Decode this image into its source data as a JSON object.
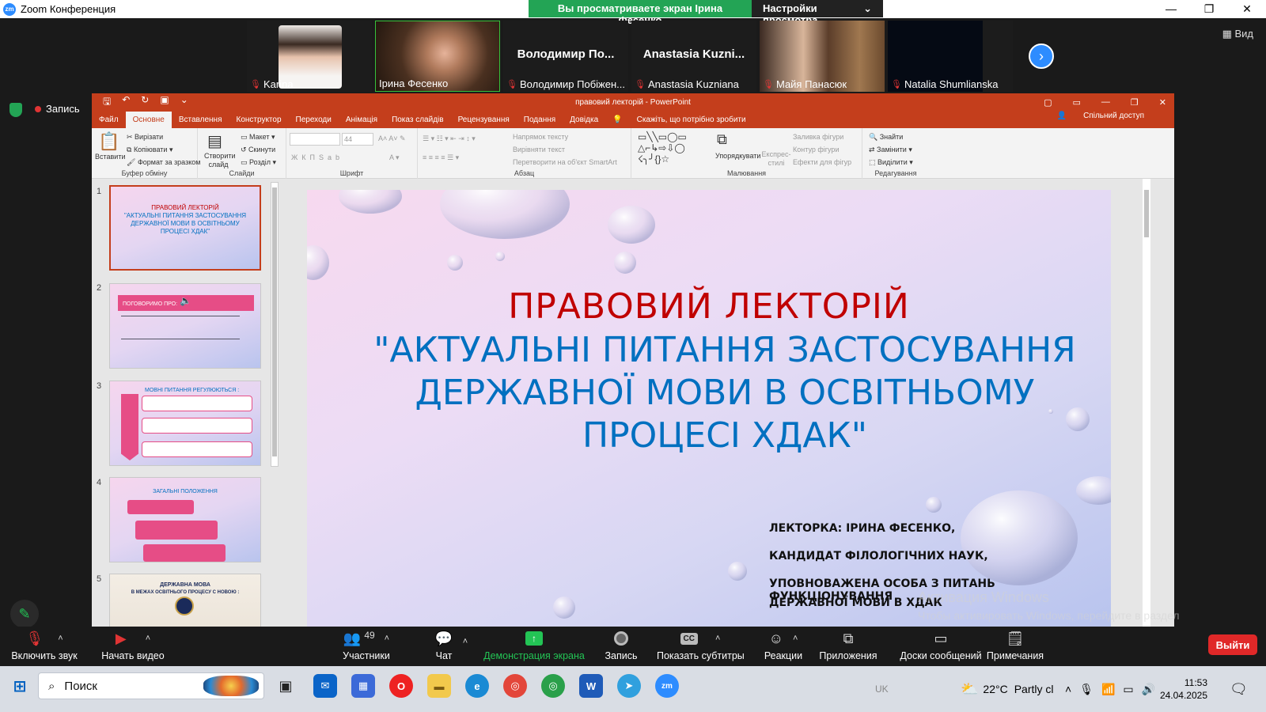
{
  "app": {
    "title": "Zoom Конференция",
    "logo": "zm"
  },
  "banner": {
    "viewing": "Вы просматриваете экран Ірина Фесенко",
    "view_settings": "Настройки просмотра"
  },
  "participants_strip": [
    {
      "name": "Karina",
      "type": "photo",
      "color": "#d8d2cd"
    },
    {
      "name": "Ірина Фесенко",
      "type": "photo",
      "color": "#6a4a38",
      "active": true
    },
    {
      "name": "Володимир Побіжен...",
      "big": "Володимир  По...",
      "type": "name"
    },
    {
      "name": "Anastasia Kuzniana",
      "big": "Anastasia  Kuzni...",
      "type": "name"
    },
    {
      "name": "Майя Панасюк",
      "type": "photo",
      "color": "#8b6a45"
    },
    {
      "name": "Natalia Shumlianska",
      "type": "dark"
    }
  ],
  "view_button": "Вид",
  "record_badge": "Запись",
  "ppt": {
    "window_title": "правовий лекторій  -  PowerPoint",
    "tabs": [
      "Файл",
      "Основне",
      "Вставлення",
      "Конструктор",
      "Переходи",
      "Анімація",
      "Показ слайдів",
      "Рецензування",
      "Подання",
      "Довідка"
    ],
    "tell_me": "Скажіть, що потрібно зробити",
    "share": "Спільний доступ",
    "ribbon": {
      "clipboard": {
        "paste": "Вставити",
        "cut": "Вирізати",
        "copy": "Копіювати",
        "format": "Формат за зразком",
        "label": "Буфер обміну"
      },
      "slides": {
        "new": "Створити слайд",
        "layout": "Макет",
        "reset": "Скинути",
        "section": "Розділ",
        "label": "Слайди"
      },
      "font": {
        "size": "44",
        "label": "Шрифт"
      },
      "paragraph": {
        "dir": "Напрямок тексту",
        "align": "Вирівняти текст",
        "smartart": "Перетворити на об'єкт SmartArt",
        "label": "Абзац"
      },
      "drawing": {
        "arrange": "Упорядкувати",
        "styles": "Експрес-стилі",
        "fill": "Заливка фігури",
        "outline": "Контур фігури",
        "effects": "Ефекти для фігур",
        "label": "Малювання"
      },
      "editing": {
        "find": "Знайти",
        "replace": "Замінити",
        "select": "Виділити",
        "label": "Редагування"
      }
    },
    "thumbnails": [
      {
        "num": "1",
        "lines": [
          "ПРАВОВИЙ ЛЕКТОРІЙ",
          "\"АКТУАЛЬНІ ПИТАННЯ ЗАСТОСУВАННЯ ДЕРЖАВНОЇ МОВИ В ОСВІТНЬОМУ ПРОЦЕСІ ХДАК\""
        ]
      },
      {
        "num": "2",
        "lines": [
          "ПОГОВОРИМО ПРО:"
        ]
      },
      {
        "num": "3",
        "lines": [
          "МОВНІ ПИТАННЯ РЕГУЛЮЮТЬСЯ :"
        ]
      },
      {
        "num": "4",
        "lines": [
          "ЗАГАЛЬНІ ПОЛОЖЕННЯ"
        ]
      },
      {
        "num": "5",
        "lines": [
          "ДЕРЖАВНА МОВА",
          "В МЕЖАХ ОСВІТНЬОГО ПРОЦЕСУ С НОВОЮ :"
        ]
      }
    ],
    "slide": {
      "title": "ПРАВОВИЙ ЛЕКТОРІЙ",
      "subtitle_lines": [
        "\"АКТУАЛЬНІ ПИТАННЯ ЗАСТОСУВАННЯ",
        "ДЕРЖАВНОЇ МОВИ В ОСВІТНЬОМУ",
        "ПРОЦЕСІ ХДАК\""
      ],
      "author_lines": [
        "ЛЕКТОРКА: ІРИНА ФЕСЕНКО,",
        "КАНДИДАТ ФІЛОЛОГІЧНИХ НАУК,",
        "УПОВНОВАЖЕНА ОСОБА З ПИТАНЬ ФУНКЦІОНУВАННЯ",
        "ДЕРЖАВНОЇ МОВИ В ХДАК"
      ],
      "title_color": "#c00000",
      "subtitle_color": "#0070c0"
    }
  },
  "windows_activation": {
    "title": "Активация Windows",
    "text": "Чтобы активировать Windows, перейдите в раздел \"Параметры\"."
  },
  "toolbar": {
    "unmute": "Включить звук",
    "start_video": "Начать видео",
    "participants": "Участники",
    "participants_count": "49",
    "chat": "Чат",
    "share": "Демонстрация экрана",
    "record": "Запись",
    "captions": "Показать субтитры",
    "reactions": "Реакции",
    "apps": "Приложения",
    "boards": "Доски сообщений",
    "notes": "Примечания",
    "leave": "Выйти"
  },
  "taskbar": {
    "search": "Поиск",
    "lang": "UK",
    "temp": "22°C",
    "weather": "Partly cl",
    "time": "11:53",
    "date": "24.04.2025"
  }
}
